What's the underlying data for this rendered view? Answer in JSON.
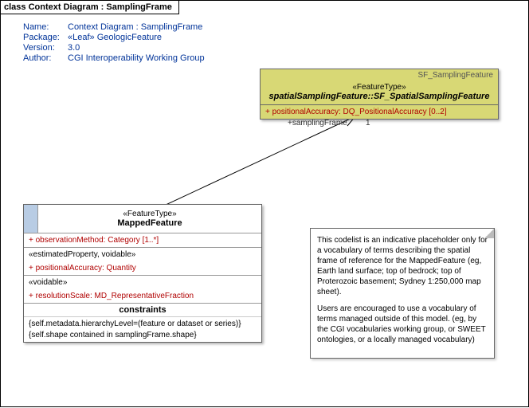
{
  "frame": {
    "title": "class Context Diagram : SamplingFrame"
  },
  "meta": {
    "name_label": "Name:",
    "name": "Context Diagram : SamplingFrame",
    "package_label": "Package:",
    "package": "«Leaf» GeologicFeature",
    "version_label": "Version:",
    "version": "3.0",
    "author_label": "Author:",
    "author": "CGI Interoperability Working Group"
  },
  "sf": {
    "corner": "SF_SamplingFeature",
    "stereo": "«FeatureType»",
    "name": "spatialSamplingFeature::SF_SpatialSamplingFeature",
    "attr": "+   positionalAccuracy:  DQ_PositionalAccuracy [0..2]"
  },
  "assoc": {
    "role": "+samplingFrame",
    "mult": "1"
  },
  "mf": {
    "stereo": "«FeatureType»",
    "name": "MappedFeature",
    "attr1": "+   observationMethod:  Category [1..*]",
    "stereo2": "«estimatedProperty, voidable»",
    "attr2": "+   positionalAccuracy:  Quantity",
    "stereo3": "«voidable»",
    "attr3": "+   resolutionScale:  MD_RepresentativeFraction",
    "constraints_h": "constraints",
    "constraint1": "{self.metadata.hierarchyLevel=(feature or dataset or series)}",
    "constraint2": "{self.shape contained in samplingFrame.shape}"
  },
  "note": {
    "p1": "This codelist is an indicative placeholder only for a vocabulary of terms describing the spatial frame of reference for the MappedFeature (eg, Earth land surface; top of bedrock; top of Proterozoic basement; Sydney 1:250,000 map sheet).",
    "p2": "Users are encouraged to use a vocabulary of terms managed outside of this model.  (eg, by the CGI vocabularies working group, or SWEET ontologies, or a locally managed vocabulary)"
  }
}
